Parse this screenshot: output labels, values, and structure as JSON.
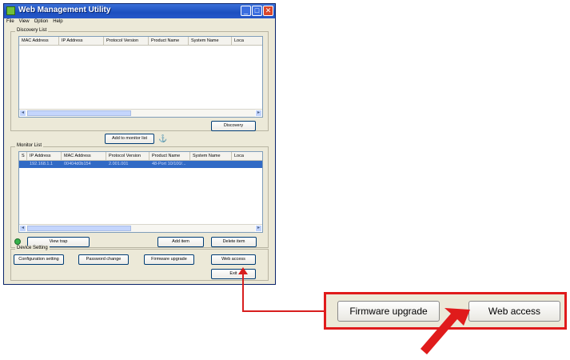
{
  "window": {
    "title": "Web Management Utility",
    "controls": {
      "minimize": "_",
      "maximize": "□",
      "close": "✕"
    }
  },
  "menu": [
    "File",
    "View",
    "Option",
    "Help"
  ],
  "discovery": {
    "group_title": "Discovery List",
    "columns": [
      "MAC Address",
      "IP Address",
      "Protocol Version",
      "Product Name",
      "System Name",
      "Loca"
    ],
    "discovery_button": "Discovery"
  },
  "add_to_monitor_button": "Add to monitor list",
  "monitor": {
    "group_title": "Monitor List",
    "columns": [
      "S",
      "IP Address",
      "MAC Address",
      "Protocol Version",
      "Product Name",
      "System Name",
      "Loca"
    ],
    "rows": [
      {
        "s": "",
        "ip": "192.168.1.1",
        "mac": "00404d0b154",
        "protocol": "2.001.001",
        "product": "48-Port 10/100/...",
        "system": "",
        "location": ""
      }
    ],
    "view_trap_button": "View trap",
    "add_item_button": "Add item",
    "delete_item_button": "Delete item"
  },
  "device_setting": {
    "group_title": "Device Setting",
    "configuration_button": "Configuration setting",
    "password_button": "Password change",
    "firmware_button": "Firmware upgrade",
    "web_access_button": "Web access",
    "exit_button": "Exit"
  },
  "zoom": {
    "firmware_button": "Firmware upgrade",
    "web_access_button": "Web access"
  },
  "colors": {
    "highlight": "#e01b1b",
    "selection": "#316ac5",
    "titlebar": "#1c4fbf"
  }
}
